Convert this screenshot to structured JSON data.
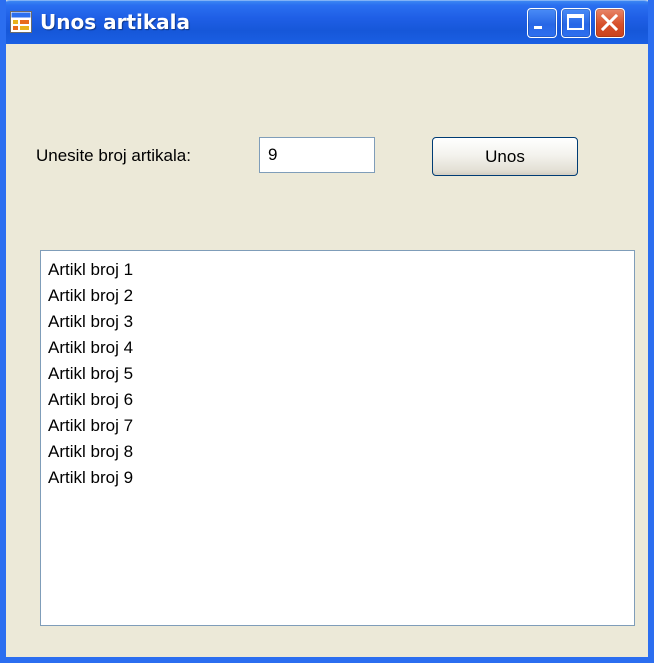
{
  "window": {
    "title": "Unos artikala",
    "icon": "form-app-icon",
    "controls": {
      "minimize_icon": "minimize-icon",
      "maximize_icon": "maximize-icon",
      "close_icon": "close-icon"
    },
    "colors": {
      "titlebar": "#1f5fe6",
      "client_background": "#ece9d8",
      "close_button": "#d7502a"
    }
  },
  "form": {
    "prompt_label": "Unesite broj artikala:",
    "count_value": "9",
    "submit_label": "Unos"
  },
  "list": {
    "items": [
      "Artikl broj 1",
      "Artikl broj 2",
      "Artikl broj 3",
      "Artikl broj 4",
      "Artikl broj 5",
      "Artikl broj 6",
      "Artikl broj 7",
      "Artikl broj 8",
      "Artikl broj 9"
    ]
  }
}
